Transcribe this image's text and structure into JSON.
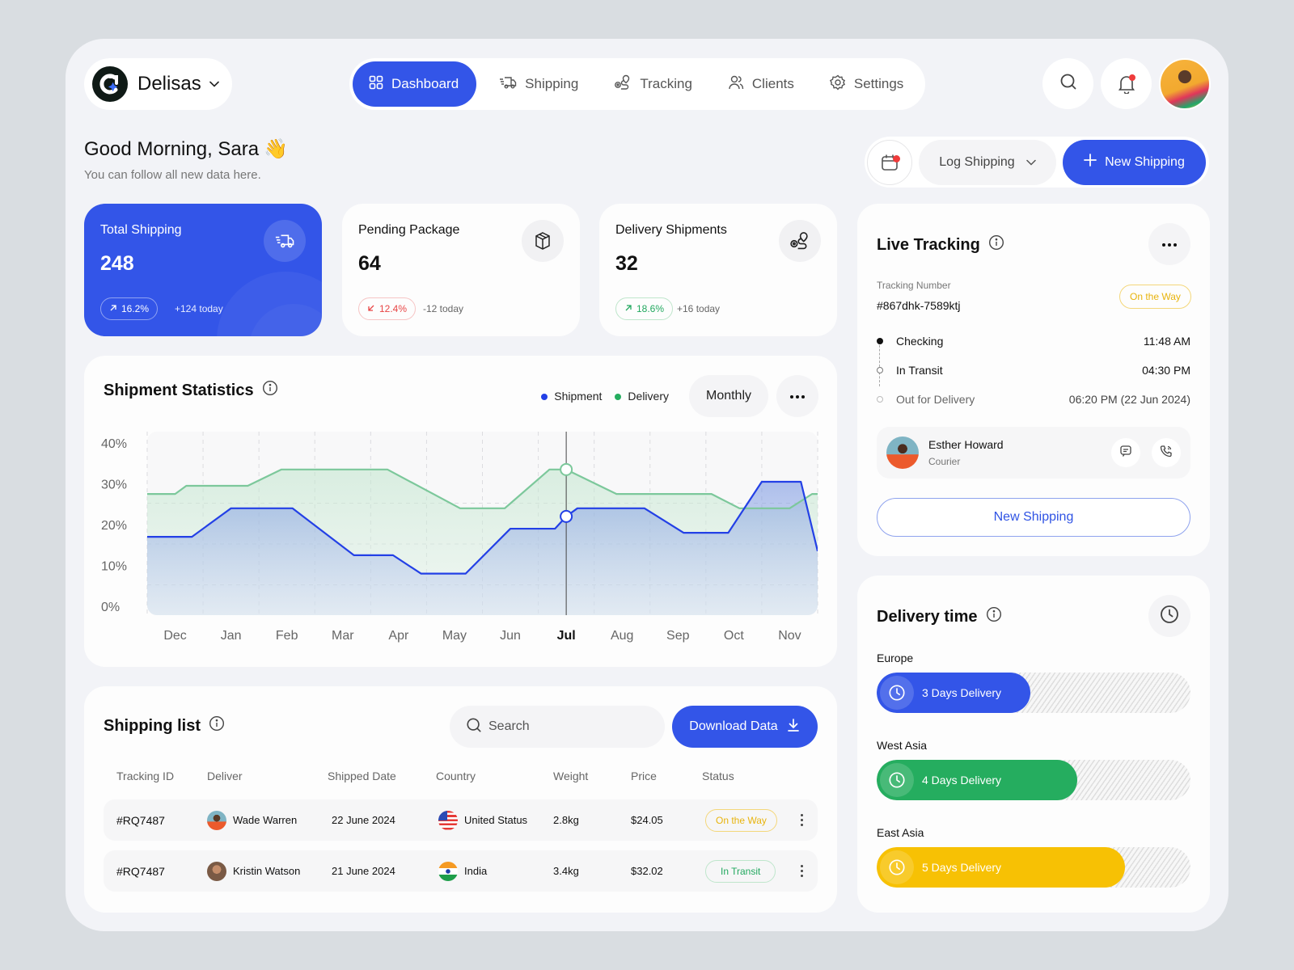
{
  "brand": {
    "name": "Delisas"
  },
  "nav": {
    "items": [
      {
        "label": "Dashboard",
        "icon": "grid-icon",
        "active": true
      },
      {
        "label": "Shipping",
        "icon": "truck-icon",
        "active": false
      },
      {
        "label": "Tracking",
        "icon": "route-icon",
        "active": false
      },
      {
        "label": "Clients",
        "icon": "users-icon",
        "active": false
      },
      {
        "label": "Settings",
        "icon": "gear-icon",
        "active": false
      }
    ]
  },
  "greeting": {
    "title": "Good Morning, Sara",
    "emoji": "👋",
    "subtitle": "You can follow all new data here."
  },
  "actions": {
    "log_label": "Log Shipping",
    "new_label": "New Shipping"
  },
  "stats": [
    {
      "title": "Total Shipping",
      "value": "248",
      "change": "16.2%",
      "direction": "up",
      "today": "+124 today"
    },
    {
      "title": "Pending Package",
      "value": "64",
      "change": "12.4%",
      "direction": "down",
      "today": "-12 today"
    },
    {
      "title": "Delivery Shipments",
      "value": "32",
      "change": "18.6%",
      "direction": "up",
      "today": "+16 today"
    }
  ],
  "chart_card": {
    "title": "Shipment Statistics",
    "period": "Monthly"
  },
  "chart_data": {
    "type": "area",
    "title": "Shipment Statistics",
    "categories": [
      "Dec",
      "Jan",
      "Feb",
      "Mar",
      "Apr",
      "May",
      "Jun",
      "Jul",
      "Aug",
      "Sep",
      "Oct",
      "Nov"
    ],
    "highlighted_category": "Jul",
    "ylim": [
      0,
      40
    ],
    "yticks": [
      "0%",
      "10%",
      "20%",
      "30%",
      "40%"
    ],
    "legend_position": "top-right",
    "grid": true,
    "series": [
      {
        "name": "Shipment",
        "color": "#2340e6",
        "points": [
          [
            -0.5,
            17
          ],
          [
            0.3,
            17
          ],
          [
            1.0,
            24
          ],
          [
            2.1,
            24
          ],
          [
            3.2,
            12.5
          ],
          [
            3.9,
            12.5
          ],
          [
            4.4,
            8
          ],
          [
            5.2,
            8
          ],
          [
            6.0,
            19
          ],
          [
            6.8,
            19
          ],
          [
            7.0,
            22
          ],
          [
            7.2,
            24
          ],
          [
            8.4,
            24
          ],
          [
            9.1,
            18
          ],
          [
            9.9,
            18
          ],
          [
            10.5,
            30.5
          ],
          [
            11.2,
            30.5
          ],
          [
            11.9,
            13.5
          ],
          [
            12.5,
            13.5
          ]
        ]
      },
      {
        "name": "Delivery",
        "color": "#7cc89b",
        "points": [
          [
            -0.5,
            27.5
          ],
          [
            0.0,
            27.5
          ],
          [
            0.2,
            29.5
          ],
          [
            1.3,
            29.5
          ],
          [
            1.9,
            33.5
          ],
          [
            3.8,
            33.5
          ],
          [
            5.1,
            24
          ],
          [
            5.9,
            24
          ],
          [
            6.7,
            33.5
          ],
          [
            7.0,
            33.5
          ],
          [
            7.9,
            27.5
          ],
          [
            9.6,
            27.5
          ],
          [
            10.1,
            24
          ],
          [
            11.0,
            24
          ],
          [
            11.4,
            27.5
          ],
          [
            12.5,
            27.5
          ]
        ]
      }
    ],
    "tooltip_point": {
      "category": "Jul",
      "shipment": 22,
      "delivery": 33.5
    }
  },
  "shipping_list": {
    "title": "Shipping list",
    "search_placeholder": "Search",
    "download_label": "Download Data",
    "columns": [
      "Tracking ID",
      "Deliver",
      "Shipped Date",
      "Country",
      "Weight",
      "Price",
      "Status"
    ],
    "rows": [
      {
        "id": "#RQ7487",
        "deliver": "Wade Warren",
        "date": "22 June 2024",
        "country": "United Status",
        "flag": "us",
        "weight": "2.8kg",
        "price": "$24.05",
        "status": "On the Way",
        "status_color": "#e8b40d"
      },
      {
        "id": "#RQ7487",
        "deliver": "Kristin Watson",
        "date": "21 June 2024",
        "country": "India",
        "flag": "in",
        "weight": "3.4kg",
        "price": "$32.02",
        "status": "In Transit",
        "status_color": "#22a85f"
      }
    ]
  },
  "live_tracking": {
    "title": "Live Tracking",
    "tracking_label": "Tracking Number",
    "tracking_number": "#867dhk-7589ktj",
    "status": "On the Way",
    "steps": [
      {
        "label": "Checking",
        "time": "11:48 AM",
        "state": "done"
      },
      {
        "label": "In Transit",
        "time": "04:30 PM",
        "state": "current"
      },
      {
        "label": "Out for Delivery",
        "time": "06:20 PM (22 Jun 2024)",
        "state": "pending"
      }
    ],
    "courier": {
      "name": "Esther Howard",
      "role": "Courier"
    },
    "button_label": "New Shipping"
  },
  "delivery_time": {
    "title": "Delivery time",
    "regions": [
      {
        "region": "Europe",
        "label": "3 Days Delivery",
        "progress": 0.49,
        "color": "#3355e8"
      },
      {
        "region": "West Asia",
        "label": "4 Days Delivery",
        "progress": 0.64,
        "color": "#25ad5f"
      },
      {
        "region": "East Asia",
        "label": "5 Days Delivery",
        "progress": 0.79,
        "color": "#f7c104"
      }
    ]
  }
}
